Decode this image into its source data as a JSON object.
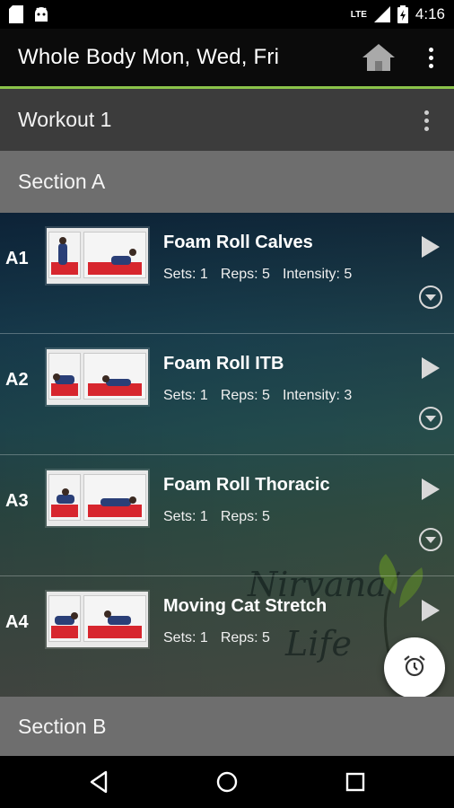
{
  "status_bar": {
    "time": "4:16",
    "network": "LTE",
    "icons": [
      "sd-card-icon",
      "android-icon",
      "signal-icon",
      "battery-icon"
    ]
  },
  "app_bar": {
    "title": "Whole Body Mon, Wed, Fri",
    "icons": [
      "home-icon",
      "overflow-menu-icon"
    ],
    "accent_color": "#8bc34a"
  },
  "workout": {
    "title": "Workout 1"
  },
  "sections": [
    {
      "title": "Section A"
    },
    {
      "title": "Section B"
    }
  ],
  "exercises": [
    {
      "id": "A1",
      "name": "Foam Roll Calves",
      "sets": "Sets: 1",
      "reps": "Reps: 5",
      "intensity": "Intensity: 5"
    },
    {
      "id": "A2",
      "name": "Foam Roll ITB",
      "sets": "Sets: 1",
      "reps": "Reps: 5",
      "intensity": "Intensity: 3"
    },
    {
      "id": "A3",
      "name": "Foam Roll Thoracic",
      "sets": "Sets: 1",
      "reps": "Reps: 5",
      "intensity": ""
    },
    {
      "id": "A4",
      "name": "Moving Cat Stretch",
      "sets": "Sets: 1",
      "reps": "Reps: 5",
      "intensity": ""
    }
  ],
  "watermark": {
    "line1": "Nirvana",
    "line2": "Life"
  },
  "fab": {
    "icon": "alarm-clock-icon"
  },
  "nav_bar": {
    "icons": [
      "back-icon",
      "home-circle-icon",
      "recents-icon"
    ]
  }
}
